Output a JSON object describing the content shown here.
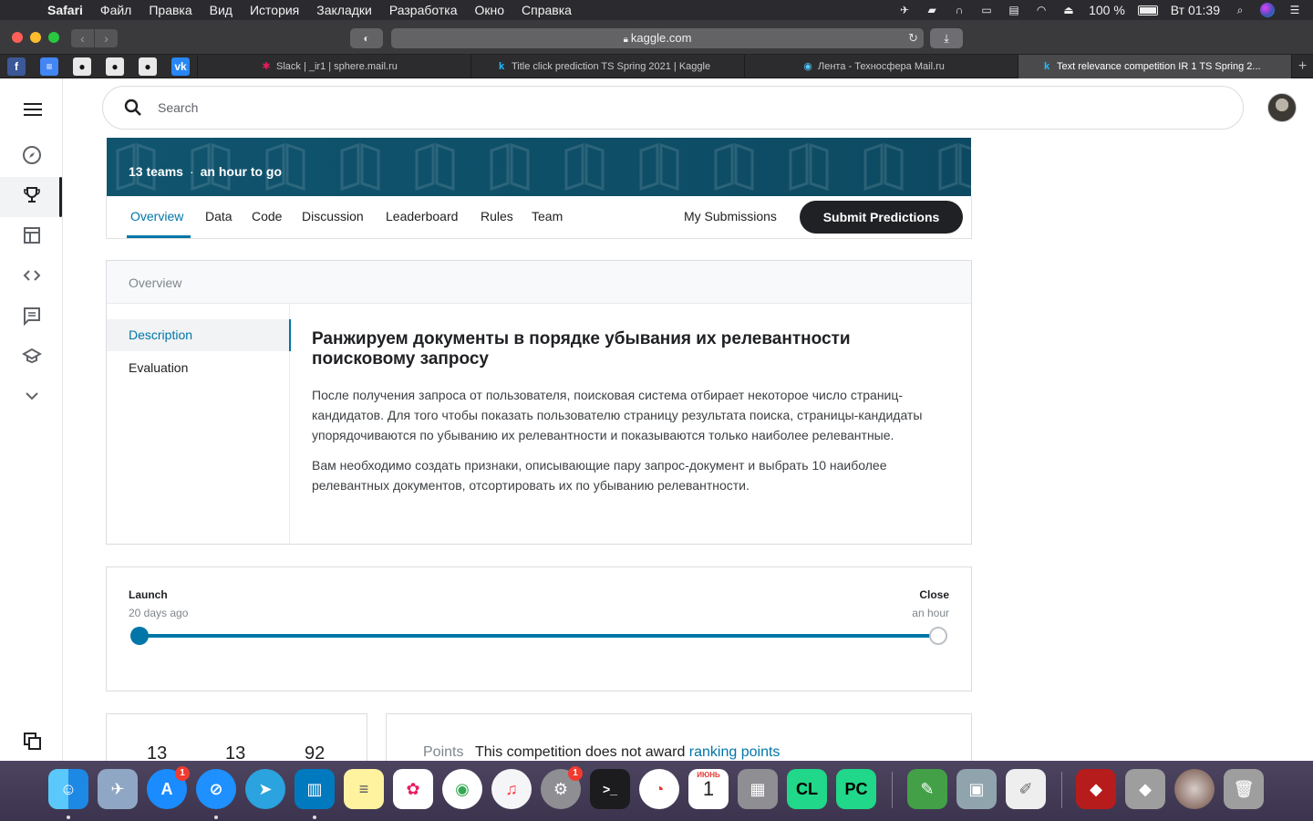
{
  "menubar": {
    "items": [
      "Safari",
      "Файл",
      "Правка",
      "Вид",
      "История",
      "Закладки",
      "Разработка",
      "Окно",
      "Справка"
    ],
    "battery": "100 %",
    "clock": "Вт 01:39"
  },
  "browser": {
    "url": "kaggle.com",
    "tabs": [
      {
        "label": "Slack | _ir1 | sphere.mail.ru"
      },
      {
        "label": "Title click prediction TS Spring 2021 | Kaggle"
      },
      {
        "label": "Лента - Техносфера Mail.ru"
      },
      {
        "label": "Text relevance competition IR 1 TS Spring 2..."
      }
    ]
  },
  "search": {
    "placeholder": "Search"
  },
  "competition": {
    "teams": "13 teams",
    "deadline": "an hour to go",
    "tabs": [
      "Overview",
      "Data",
      "Code",
      "Discussion",
      "Leaderboard",
      "Rules",
      "Team"
    ],
    "my_submissions": "My Submissions",
    "submit": "Submit Predictions"
  },
  "overview": {
    "header": "Overview",
    "side": [
      "Description",
      "Evaluation"
    ],
    "title": "Ранжируем документы в порядке убывания их релевантности поисковому запросу",
    "paragraphs": [
      "После получения запроса от пользователя, поисковая система отбирает некоторое число страниц-кандидатов. Для того чтобы показать пользователю страницу результата поиска, страницы-кандидаты упорядочиваются по убыванию их релевантности и показываются только наиболее релевантные.",
      "Вам необходимо создать признаки, описывающие пару запрос-документ и выбрать 10 наиболее релевантных документов, отсортировать их по убыванию релевантности."
    ]
  },
  "timeline": {
    "launch_label": "Launch",
    "launch_sub": "20 days ago",
    "close_label": "Close",
    "close_sub": "an hour",
    "progress": 1.0
  },
  "stats": {
    "values": [
      "13",
      "13",
      "92"
    ]
  },
  "points": {
    "label": "Points",
    "text": "This competition does not award",
    "link": "ranking points"
  },
  "dock": {
    "badges": {
      "appstore": "1",
      "settings": "1"
    },
    "calendar_month": "ИЮНЬ",
    "calendar_day": "1"
  },
  "colors": {
    "accent": "#0076a8",
    "banner": "#10546e",
    "dark": "#202124"
  }
}
